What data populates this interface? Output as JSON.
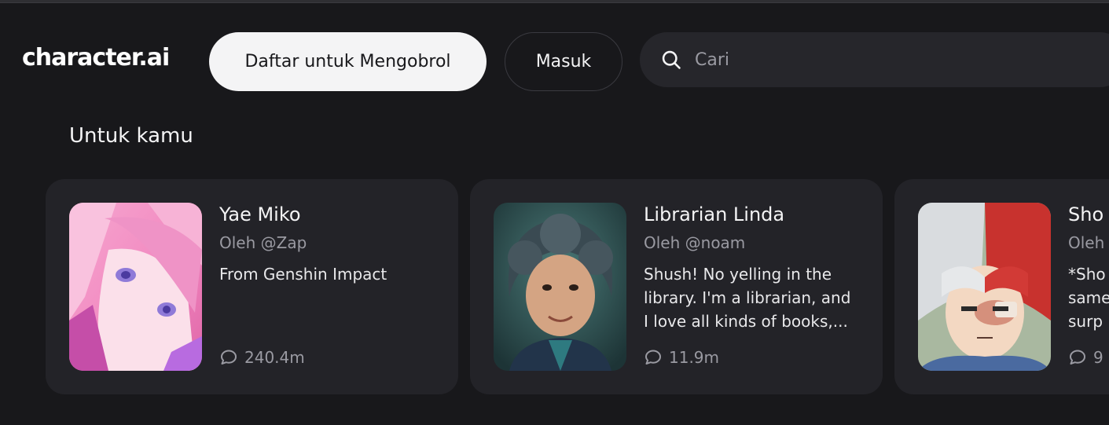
{
  "header": {
    "logo": "character.ai",
    "signup_label": "Daftar untuk Mengobrol",
    "login_label": "Masuk",
    "search_placeholder": "Cari"
  },
  "section": {
    "title": "Untuk kamu"
  },
  "cards": [
    {
      "name": "Yae Miko",
      "author": "Oleh @Zap",
      "description": "From Genshin Impact",
      "interactions": "240.4m"
    },
    {
      "name": "Librarian Linda",
      "author": "Oleh @noam",
      "description": "Shush! No yelling in the library. I'm a librarian, and I love all kinds of books,...",
      "interactions": "11.9m"
    },
    {
      "name": "Sho",
      "author": "Oleh",
      "description": "*Sho same surp",
      "interactions": "9"
    }
  ],
  "colors": {
    "background": "#18181b",
    "card": "#232328",
    "search": "#26262b",
    "primary_button": "#f4f4f5",
    "muted_text": "#9a9aa2"
  },
  "icons": {
    "search": "search-icon",
    "interactions": "chat-bubble-icon"
  }
}
